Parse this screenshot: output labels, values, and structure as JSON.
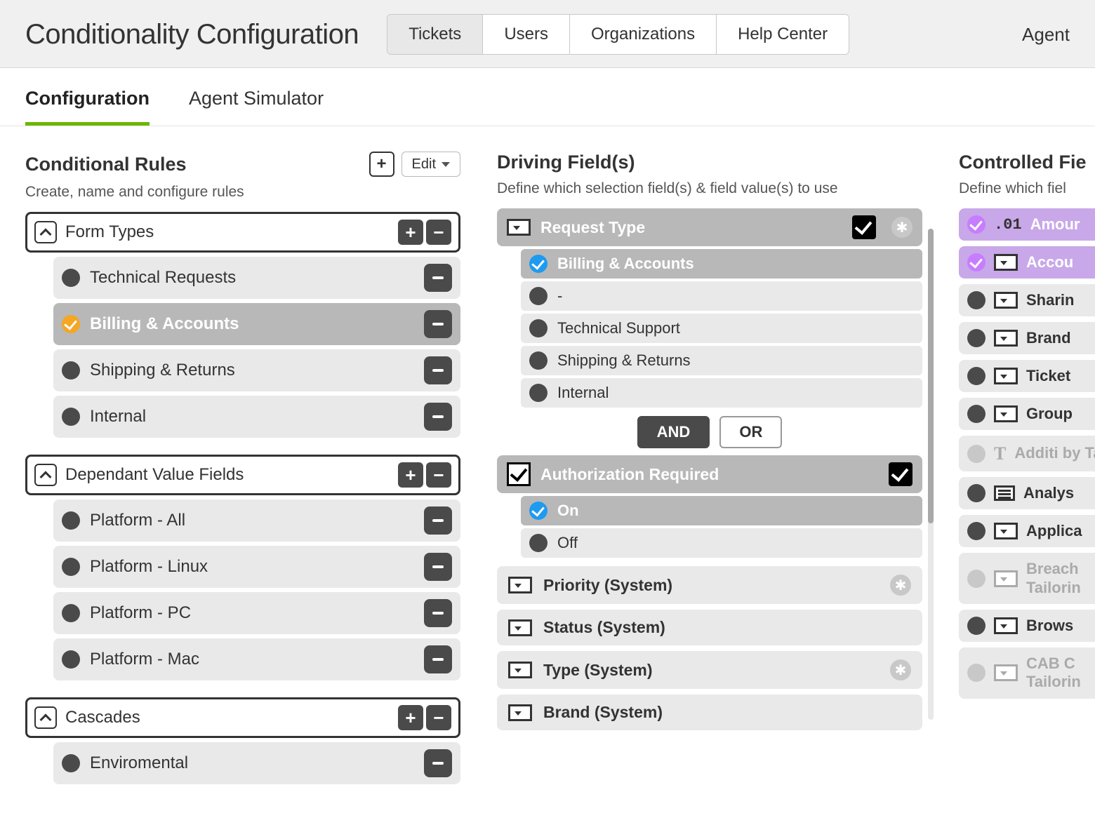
{
  "header": {
    "title": "Conditionality Configuration",
    "tabs": [
      "Tickets",
      "Users",
      "Organizations",
      "Help Center"
    ],
    "active_tab": 0,
    "right_label": "Agent"
  },
  "subtabs": {
    "items": [
      "Configuration",
      "Agent Simulator"
    ],
    "active": 0
  },
  "rules": {
    "title": "Conditional Rules",
    "subtitle": "Create, name and configure rules",
    "edit_label": "Edit",
    "groups": [
      {
        "label": "Form Types",
        "items": [
          {
            "label": "Technical Requests",
            "selected": false
          },
          {
            "label": "Billing & Accounts",
            "selected": true
          },
          {
            "label": "Shipping & Returns",
            "selected": false
          },
          {
            "label": "Internal",
            "selected": false
          }
        ]
      },
      {
        "label": "Dependant Value Fields",
        "items": [
          {
            "label": "Platform - All",
            "selected": false
          },
          {
            "label": "Platform - Linux",
            "selected": false
          },
          {
            "label": "Platform - PC",
            "selected": false
          },
          {
            "label": "Platform - Mac",
            "selected": false
          }
        ]
      },
      {
        "label": "Cascades",
        "items": [
          {
            "label": "Enviromental",
            "selected": false
          }
        ]
      }
    ]
  },
  "driving": {
    "title": "Driving Field(s)",
    "subtitle": "Define which selection field(s) & field value(s) to use",
    "fields": [
      {
        "label": "Request Type",
        "has_star": true,
        "values": [
          {
            "label": "Billing & Accounts",
            "selected": true
          },
          {
            "label": "-",
            "selected": false
          },
          {
            "label": "Technical Support",
            "selected": false
          },
          {
            "label": "Shipping & Returns",
            "selected": false
          },
          {
            "label": "Internal",
            "selected": false
          }
        ]
      },
      {
        "label": "Authorization Required",
        "icon": "checkbox",
        "values": [
          {
            "label": "On",
            "selected": true
          },
          {
            "label": "Off",
            "selected": false
          }
        ]
      }
    ],
    "logic": {
      "and": "AND",
      "or": "OR",
      "active": "and"
    },
    "system_fields": [
      {
        "label": "Priority (System)",
        "has_star": true
      },
      {
        "label": "Status (System)",
        "has_star": false
      },
      {
        "label": "Type (System)",
        "has_star": true
      },
      {
        "label": "Brand (System)",
        "has_star": false
      }
    ]
  },
  "controlled": {
    "title": "Controlled Fie",
    "subtitle": "Define which fiel",
    "items": [
      {
        "label": "Amour",
        "icon": "decimal",
        "state": "purple"
      },
      {
        "label": "Accou",
        "icon": "dropdown",
        "state": "purple"
      },
      {
        "label": "Sharin",
        "icon": "dropdown",
        "state": "normal"
      },
      {
        "label": "Brand",
        "icon": "dropdown",
        "state": "normal"
      },
      {
        "label": "Ticket",
        "icon": "dropdown",
        "state": "normal"
      },
      {
        "label": "Group",
        "icon": "dropdown",
        "state": "normal"
      },
      {
        "label": "Additi\nby Tail",
        "icon": "text",
        "state": "muted"
      },
      {
        "label": "Analys",
        "icon": "lines",
        "state": "normal"
      },
      {
        "label": "Applica",
        "icon": "dropdown",
        "state": "normal"
      },
      {
        "label": "Breach\nTailorin",
        "icon": "dropdown",
        "state": "muted"
      },
      {
        "label": "Brows",
        "icon": "dropdown",
        "state": "normal"
      },
      {
        "label": "CAB C\nTailorin",
        "icon": "dropdown",
        "state": "muted"
      }
    ]
  }
}
